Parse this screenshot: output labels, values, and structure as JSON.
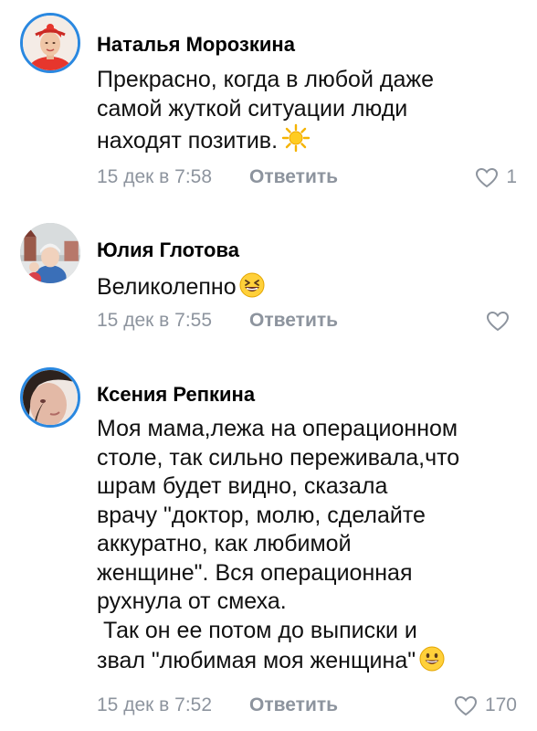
{
  "comments": [
    {
      "author": "Наталья Морозкина",
      "text_lines": [
        "Прекрасно, когда в любой даже",
        "самой жуткой ситуации люди",
        "находят позитив."
      ],
      "trailing_emoji": "sun-emoji",
      "date": "15 дек в 7:58",
      "reply_label": "Ответить",
      "likes": "1",
      "avatar_has_story_ring": true
    },
    {
      "author": "Юлия Глотова",
      "text_lines": [
        "Великолепно"
      ],
      "trailing_emoji": "laughing-face-emoji",
      "date": "15 дек в 7:55",
      "reply_label": "Ответить",
      "likes": "",
      "avatar_has_story_ring": false
    },
    {
      "author": "Ксения Репкина",
      "text_lines": [
        "Моя мама,лежа на операционном",
        "столе, так сильно переживала,что",
        "шрам будет видно, сказала",
        "врачу \"доктор, молю, сделайте",
        "аккуратно, как любимой",
        "женщине\". Вся операционная",
        "рухнула от смеха.",
        " Так он ее потом до выписки и",
        "звал \"любимая моя женщина\""
      ],
      "trailing_emoji": "smiling-face-emoji",
      "date": "15 дек в 7:52",
      "reply_label": "Ответить",
      "likes": "170",
      "avatar_has_story_ring": true
    }
  ],
  "colors": {
    "story_ring": "#2a88e0",
    "meta_text": "#8d949e",
    "author_text": "#000000",
    "body_text": "#111111"
  }
}
